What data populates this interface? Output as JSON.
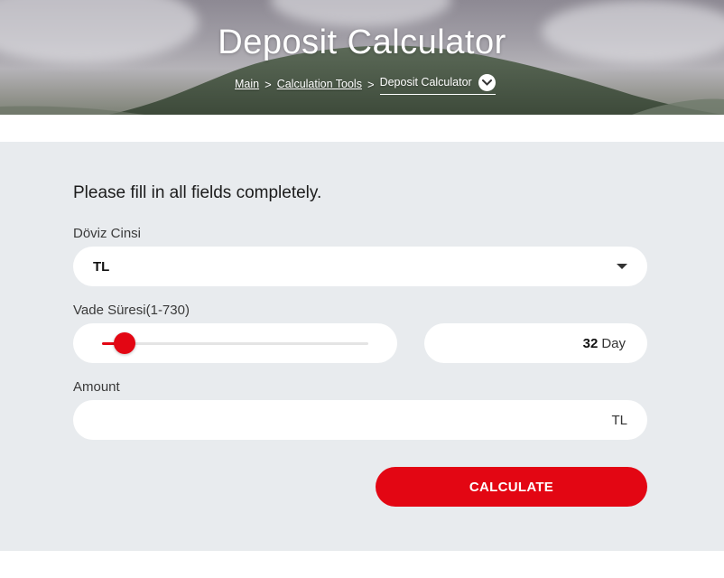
{
  "hero": {
    "title": "Deposit Calculator",
    "breadcrumb": {
      "items": [
        "Main",
        "Calculation Tools"
      ],
      "separator": ">",
      "current": "Deposit Calculator"
    }
  },
  "form": {
    "instruction": "Please fill in all fields completely.",
    "currency": {
      "label": "Döviz Cinsi",
      "selected": "TL"
    },
    "term": {
      "label": "Vade Süresi(1-730)",
      "min": 1,
      "max": 730,
      "value": "32",
      "unit": "Day"
    },
    "amount": {
      "label": "Amount",
      "value": "",
      "currency": "TL"
    },
    "submit_label": "CALCULATE"
  },
  "colors": {
    "accent": "#e30613",
    "panel_background": "#e8ebee",
    "field_background": "#ffffff"
  }
}
